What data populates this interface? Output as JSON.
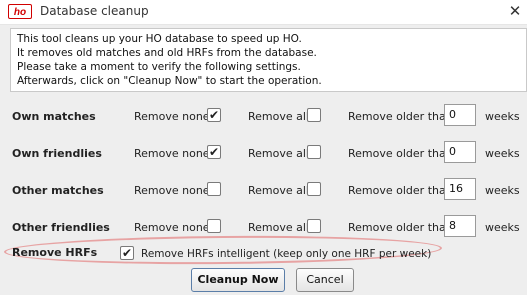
{
  "window": {
    "title": "Database cleanup",
    "app_icon_text": "ho"
  },
  "intro": {
    "lines": [
      "This tool cleans up your HO database to speed up HO.",
      "It removes old matches and old HRFs from the database.",
      "Please take a moment to verify the following settings.",
      "Afterwards, click on \"Cleanup Now\" to start the operation."
    ]
  },
  "options": {
    "remove_none_label": "Remove none",
    "remove_all_label": "Remove all",
    "remove_older_label": "Remove older than",
    "weeks_label": "weeks"
  },
  "rows": [
    {
      "label": "Own matches",
      "remove_none": true,
      "remove_all": false,
      "weeks": "0"
    },
    {
      "label": "Own friendlies",
      "remove_none": true,
      "remove_all": false,
      "weeks": "0"
    },
    {
      "label": "Other matches",
      "remove_none": false,
      "remove_all": false,
      "weeks": "16"
    },
    {
      "label": "Other friendlies",
      "remove_none": false,
      "remove_all": false,
      "weeks": "8"
    }
  ],
  "hrf": {
    "label": "Remove HRFs",
    "checked": true,
    "option_text": "Remove HRFs intelligent (keep only one HRF per week)"
  },
  "buttons": {
    "cleanup": "Cleanup Now",
    "cancel": "Cancel"
  },
  "colors": {
    "highlight": "#e7a3a3",
    "brand": "#d10000"
  }
}
